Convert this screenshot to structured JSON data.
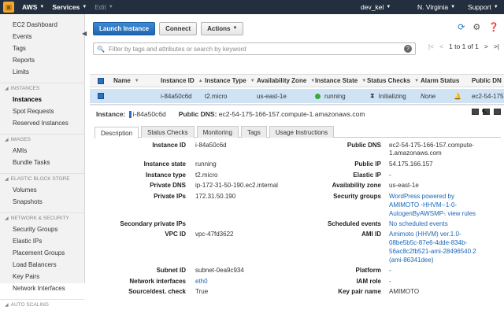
{
  "topnav": {
    "brand": "AWS",
    "services": "Services",
    "edit": "Edit",
    "user": "dev_kel",
    "region": "N. Virginia",
    "support": "Support"
  },
  "sidebar": {
    "items": [
      {
        "label": "EC2 Dashboard"
      },
      {
        "label": "Events"
      },
      {
        "label": "Tags"
      },
      {
        "label": "Reports"
      },
      {
        "label": "Limits"
      }
    ],
    "sections": [
      {
        "title": "INSTANCES",
        "items": [
          "Instances",
          "Spot Requests",
          "Reserved Instances"
        ]
      },
      {
        "title": "IMAGES",
        "items": [
          "AMIs",
          "Bundle Tasks"
        ]
      },
      {
        "title": "ELASTIC BLOCK STORE",
        "items": [
          "Volumes",
          "Snapshots"
        ]
      },
      {
        "title": "NETWORK & SECURITY",
        "items": [
          "Security Groups",
          "Elastic IPs",
          "Placement Groups",
          "Load Balancers",
          "Key Pairs",
          "Network Interfaces"
        ]
      },
      {
        "title": "AUTO SCALING",
        "items": []
      }
    ]
  },
  "toolbar": {
    "launch": "Launch Instance",
    "connect": "Connect",
    "actions": "Actions"
  },
  "filter": {
    "placeholder": "Filter by tags and attributes or search by keyword",
    "pager": "1 to 1 of 1"
  },
  "grid": {
    "columns": [
      "Name",
      "Instance ID",
      "Instance Type",
      "Availability Zone",
      "Instance State",
      "Status Checks",
      "Alarm Status",
      "Public DN"
    ],
    "row": {
      "name": "",
      "instance_id": "i-84a50c6d",
      "instance_type": "t2.micro",
      "az": "us-east-1e",
      "state": "running",
      "status": "Initializing",
      "alarm": "None",
      "public_dns": "ec2-54-175"
    }
  },
  "detail": {
    "instance_label": "Instance:",
    "instance_id": "i-84a50c6d",
    "dns_label": "Public DNS:",
    "dns": "ec2-54-175-166-157.compute-1.amazonaws.com"
  },
  "tabs": [
    "Description",
    "Status Checks",
    "Monitoring",
    "Tags",
    "Usage Instructions"
  ],
  "description": {
    "left": [
      {
        "k": "Instance ID",
        "v": "i-84a50c6d"
      },
      {
        "k": "Instance state",
        "v": "running"
      },
      {
        "k": "Instance type",
        "v": "t2.micro"
      },
      {
        "k": "Private DNS",
        "v": "ip-172-31-50-190.ec2.internal"
      },
      {
        "k": "Private IPs",
        "v": "172.31.50.190"
      },
      {
        "k": "Secondary private IPs",
        "v": ""
      },
      {
        "k": "VPC ID",
        "v": "vpc-47fd3622"
      },
      {
        "k": "Subnet ID",
        "v": "subnet-0ea9c934"
      },
      {
        "k": "Network interfaces",
        "v": "eth0"
      },
      {
        "k": "Source/dest. check",
        "v": "True"
      }
    ],
    "right": [
      {
        "k": "Public DNS",
        "v1": "ec2-54-175-166-157.compute-",
        "v2": "1.amazonaws.com"
      },
      {
        "k": "Public IP",
        "v": "54.175.166.157"
      },
      {
        "k": "Elastic IP",
        "v": "-"
      },
      {
        "k": "Availability zone",
        "v": "us-east-1e"
      },
      {
        "k": "Security groups",
        "v1": "WordPress powered by",
        "v2": "AMIMOTO -HHVM--1-0-",
        "v3": "AutogenByAWSMP-",
        "v4": ". view rules"
      },
      {
        "k": "Scheduled events",
        "v": "No scheduled events"
      },
      {
        "k": "AMI ID",
        "v1": "Amimoto (HHVM) ver.1.0-",
        "v2": "08be5b5c-87e6-4dde-834b-",
        "v3": "56ac8c2fb521-ami-28496540.2",
        "v4": "(ami-86341dee)"
      },
      {
        "k": "Platform",
        "v": "-"
      },
      {
        "k": "IAM role",
        "v": "-"
      },
      {
        "k": "Key pair name",
        "v": "AMIMOTO"
      }
    ]
  },
  "colors": {
    "nav_bg": "#232f3e",
    "primary": "#1f66b0",
    "selected_row": "#cfe3f5",
    "running": "#3aa83a"
  }
}
